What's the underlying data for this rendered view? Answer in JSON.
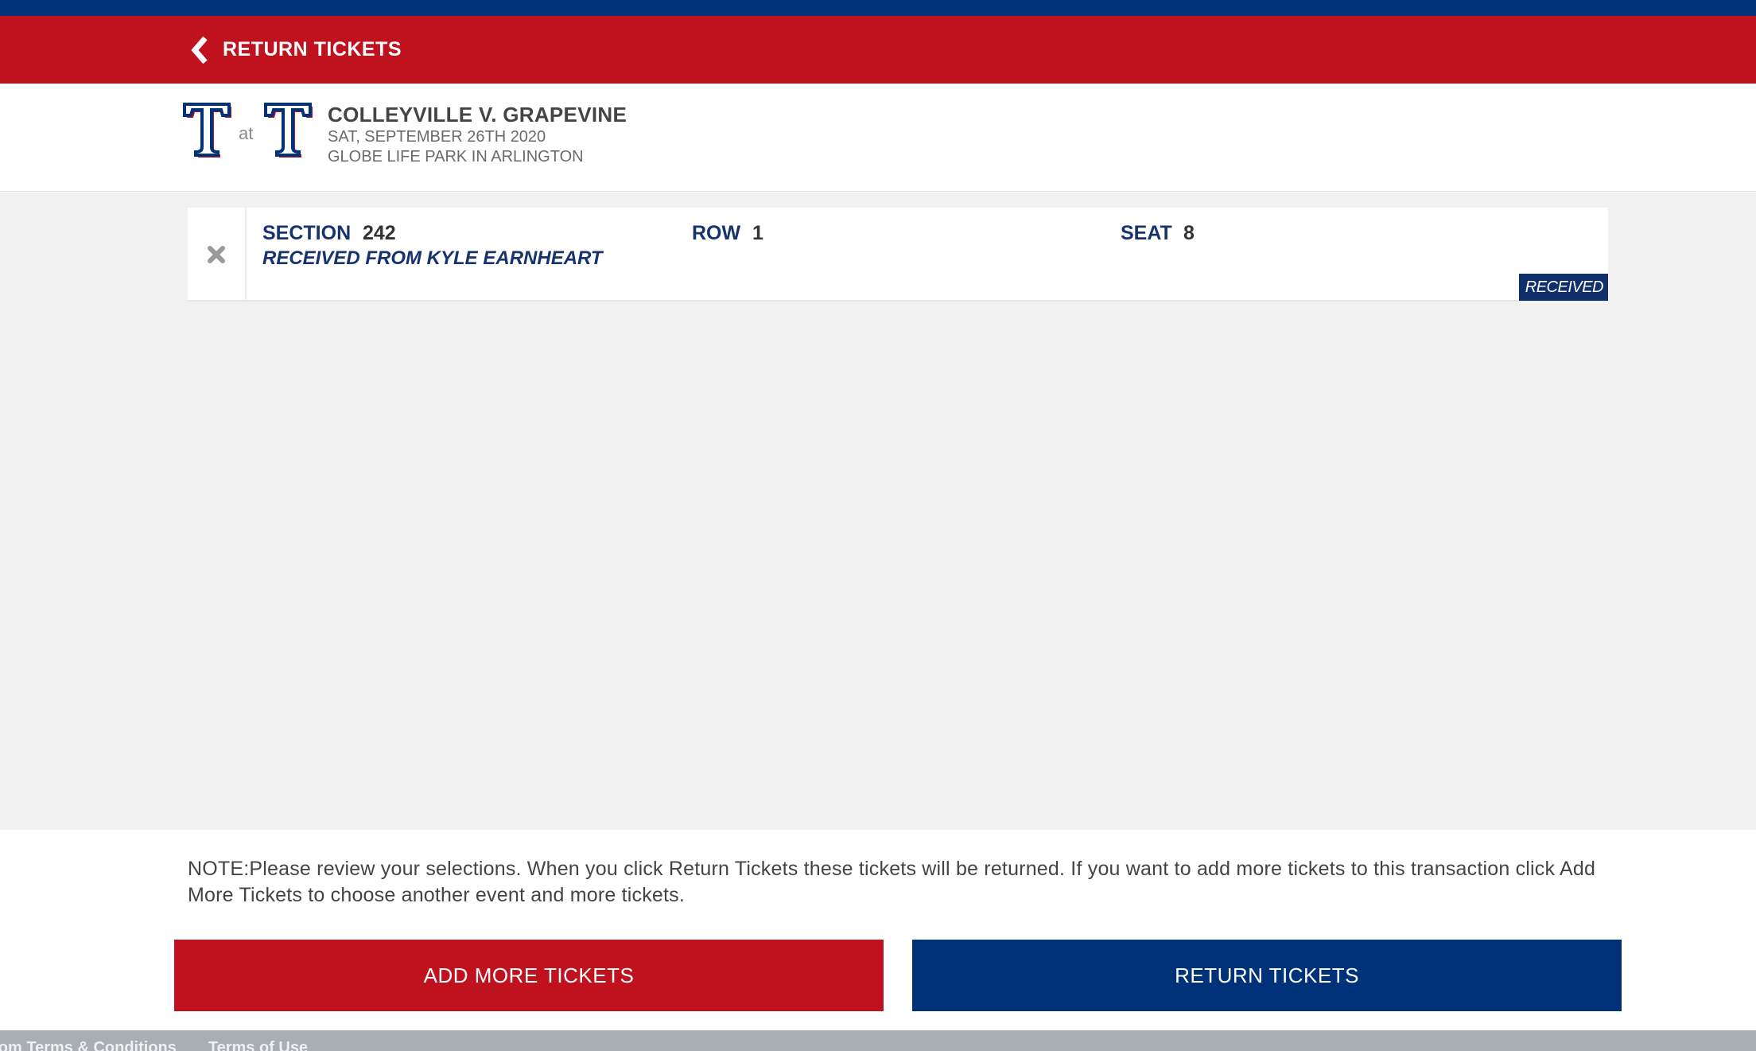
{
  "header": {
    "back_label": "RETURN TICKETS"
  },
  "event": {
    "away_logo": "texas-rangers-t-logo",
    "at_text": "at",
    "home_logo": "texas-rangers-t-logo",
    "title": "COLLEYVILLE V. GRAPEVINE",
    "date": "SAT, SEPTEMBER 26TH 2020",
    "venue": "GLOBE LIFE PARK IN ARLINGTON"
  },
  "ticket": {
    "section_label": "SECTION",
    "section_value": "242",
    "row_label": "ROW",
    "row_value": "1",
    "seat_label": "SEAT",
    "seat_value": "8",
    "received_from": "RECEIVED FROM KYLE EARNHEART",
    "status": "RECEIVED",
    "remove_icon": "close-x-icon"
  },
  "note": "NOTE:Please review your selections. When you click Return Tickets these tickets will be returned. If you want to add more tickets to this transaction click Add More Tickets to choose another event and more tickets.",
  "buttons": {
    "add_more": "ADD MORE TICKETS",
    "return": "RETURN TICKETS"
  },
  "footer": {
    "links": [
      "...com Terms & Conditions",
      "Terms of Use"
    ]
  },
  "colors": {
    "navy": "#003279",
    "red": "#c0111f",
    "badge": "#0f2f6b",
    "gray_bg": "#f1f1f1"
  }
}
